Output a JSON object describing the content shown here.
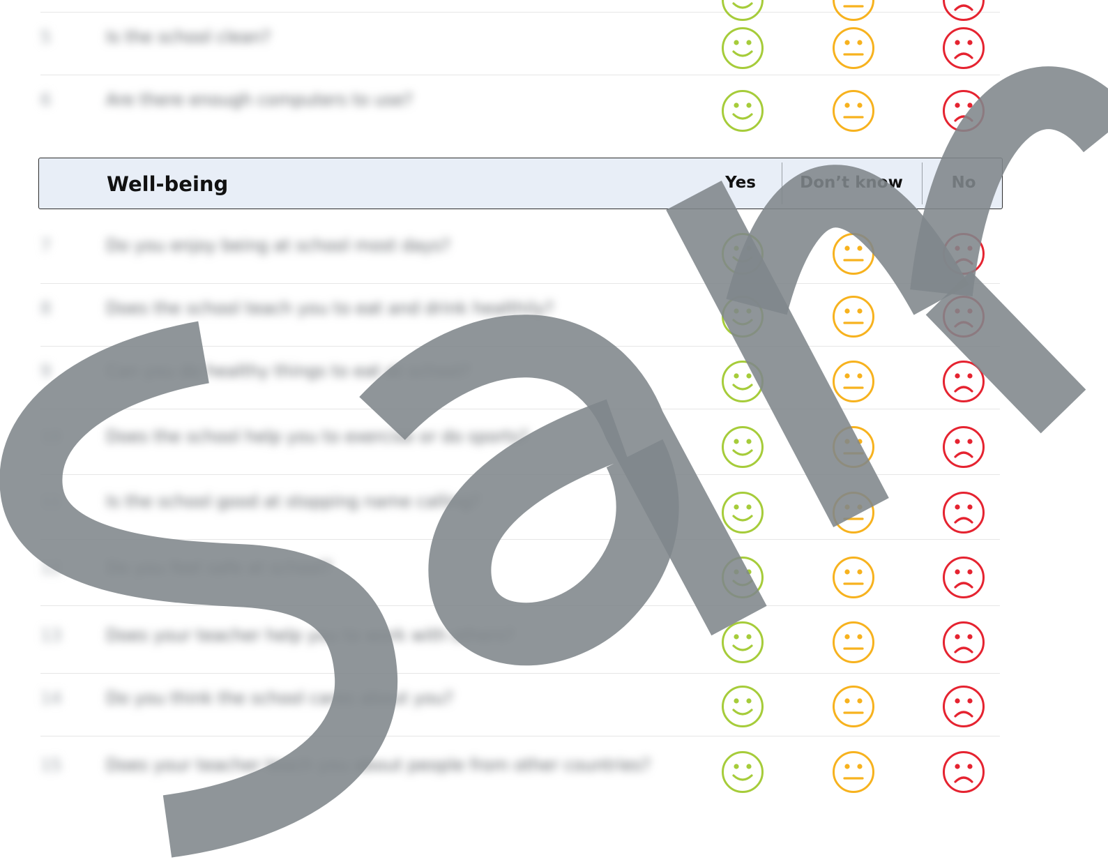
{
  "section": {
    "title": "Well-being",
    "columns": {
      "yes": "Yes",
      "dont_know": "Don’t know",
      "no": "No"
    }
  },
  "top_rows": [
    {
      "number": "5",
      "question": "Is the school clean?"
    },
    {
      "number": "6",
      "question": "Are there enough computers to use?"
    }
  ],
  "wellbeing_rows": [
    {
      "number": "7",
      "question": "Do you enjoy being at school most days?"
    },
    {
      "number": "8",
      "question": "Does the school teach you to eat and drink healthily?"
    },
    {
      "number": "9",
      "question": "Can you do healthy things to eat at school?"
    },
    {
      "number": "10",
      "question": "Does the school help you to exercise or do sports?"
    },
    {
      "number": "11",
      "question": "Is the school good at stopping name calling?"
    },
    {
      "number": "12",
      "question": "Do you feel safe at school?"
    },
    {
      "number": "13",
      "question": "Does your teacher help you to work with others?"
    },
    {
      "number": "14",
      "question": "Do you think the school cares about you?"
    },
    {
      "number": "15",
      "question": "Does your teacher teach you about people from other countries?"
    }
  ],
  "colors": {
    "yes": "#a6cc3a",
    "dont_know": "#f7b21e",
    "no": "#e52330",
    "watermark": "#7f868b"
  },
  "icons": {
    "yes": "happy-face-icon",
    "dont_know": "neutral-face-icon",
    "no": "sad-face-icon"
  }
}
